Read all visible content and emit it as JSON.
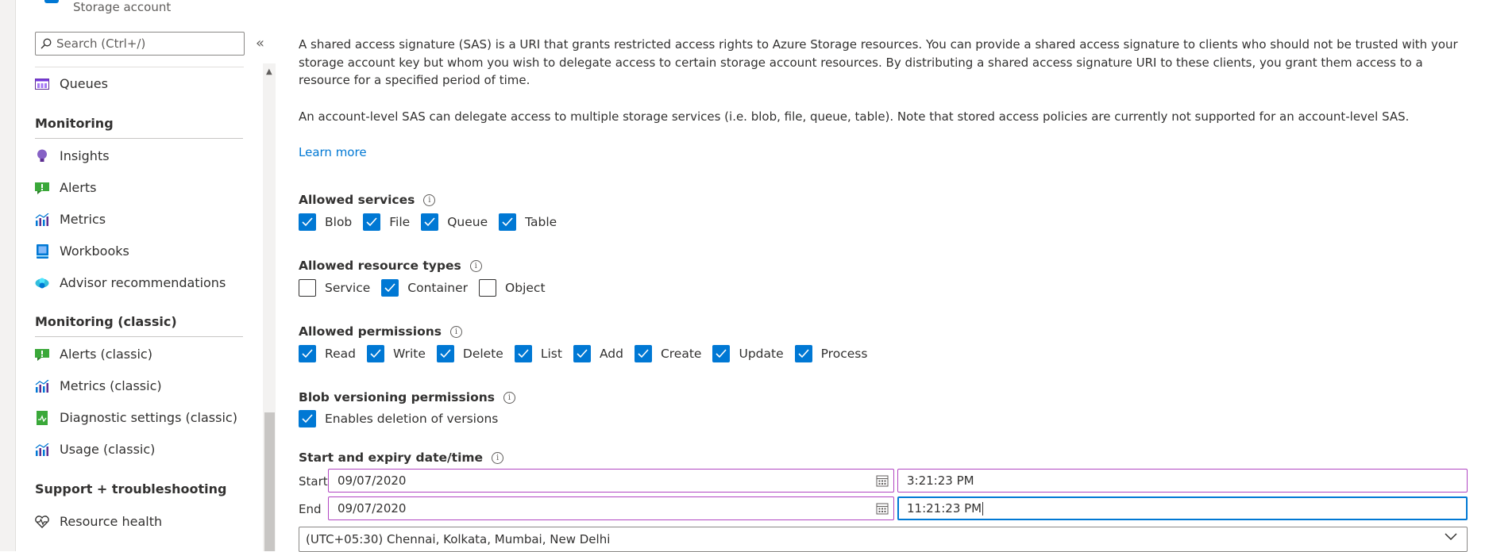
{
  "header": {
    "subtitle": "Storage account"
  },
  "sidebar": {
    "search_placeholder": "Search (Ctrl+/)",
    "collapse_glyph": "«",
    "queues": "Queues",
    "monitoring_title": "Monitoring",
    "monitoring_items": [
      "Insights",
      "Alerts",
      "Metrics",
      "Workbooks",
      "Advisor recommendations"
    ],
    "classic_title": "Monitoring (classic)",
    "classic_items": [
      "Alerts (classic)",
      "Metrics (classic)",
      "Diagnostic settings (classic)",
      "Usage (classic)"
    ],
    "support_title": "Support + troubleshooting",
    "support_items": [
      "Resource health"
    ]
  },
  "main": {
    "intro": "A shared access signature (SAS) is a URI that grants restricted access rights to Azure Storage resources. You can provide a shared access signature to clients who should not be trusted with your storage account key but whom you wish to delegate access to certain storage account resources. By distributing a shared access signature URI to these clients, you grant them access to a resource for a specified period of time.",
    "account_note": "An account-level SAS can delegate access to multiple storage services (i.e. blob, file, queue, table). Note that stored access policies are currently not supported for an account-level SAS.",
    "learn_more": "Learn more",
    "allowed_services": {
      "label": "Allowed services",
      "options": [
        {
          "label": "Blob",
          "checked": true
        },
        {
          "label": "File",
          "checked": true
        },
        {
          "label": "Queue",
          "checked": true
        },
        {
          "label": "Table",
          "checked": true
        }
      ]
    },
    "resource_types": {
      "label": "Allowed resource types",
      "options": [
        {
          "label": "Service",
          "checked": false
        },
        {
          "label": "Container",
          "checked": true
        },
        {
          "label": "Object",
          "checked": false
        }
      ]
    },
    "permissions": {
      "label": "Allowed permissions",
      "options": [
        {
          "label": "Read",
          "checked": true
        },
        {
          "label": "Write",
          "checked": true
        },
        {
          "label": "Delete",
          "checked": true
        },
        {
          "label": "List",
          "checked": true
        },
        {
          "label": "Add",
          "checked": true
        },
        {
          "label": "Create",
          "checked": true
        },
        {
          "label": "Update",
          "checked": true
        },
        {
          "label": "Process",
          "checked": true
        }
      ]
    },
    "versioning": {
      "label": "Blob versioning permissions",
      "options": [
        {
          "label": "Enables deletion of versions",
          "checked": true
        }
      ]
    },
    "datetime": {
      "label": "Start and expiry date/time",
      "start_label": "Start",
      "end_label": "End",
      "start_date": "09/07/2020",
      "start_time": "3:21:23 PM",
      "end_date": "09/07/2020",
      "end_time": "11:21:23 PM"
    },
    "timezone": "(UTC+05:30) Chennai, Kolkata, Mumbai, New Delhi"
  },
  "colors": {
    "accent": "#0078d4",
    "invalid_border": "#b146c2"
  }
}
